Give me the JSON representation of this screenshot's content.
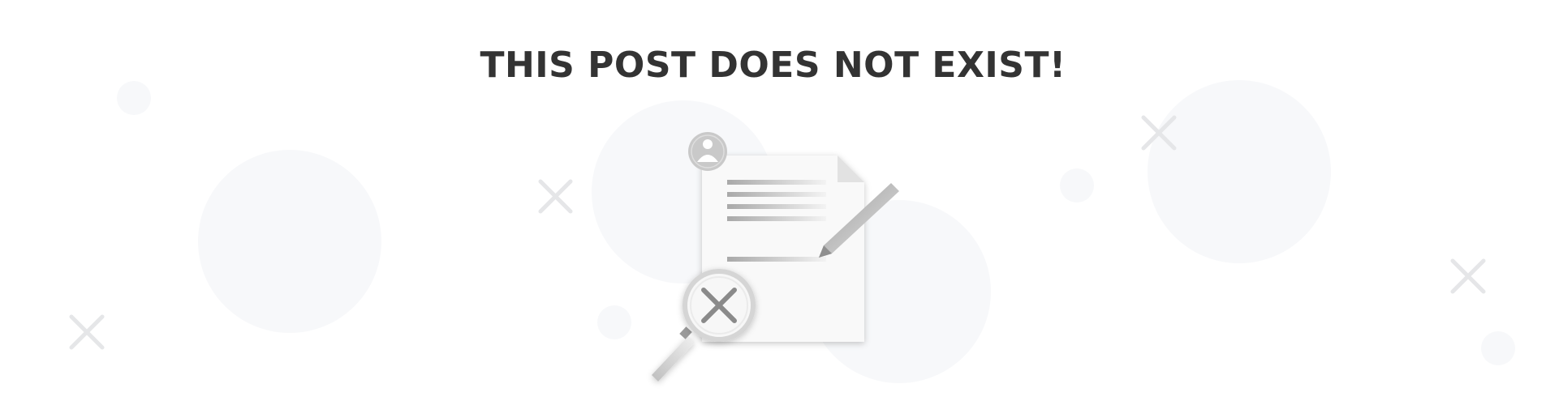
{
  "message": {
    "title": "THIS POST DOES NOT EXIST!"
  },
  "illustration": {
    "icons": [
      "user-icon",
      "document-icon",
      "pencil-icon",
      "magnifier-icon",
      "close-icon"
    ],
    "colors": {
      "circle": "#f7f8fa",
      "cross": "#e5e6e8",
      "paper": "#f9f9f9",
      "line": "#b5b5b5",
      "badge": "#c9c9c9",
      "title": "#333333"
    }
  }
}
